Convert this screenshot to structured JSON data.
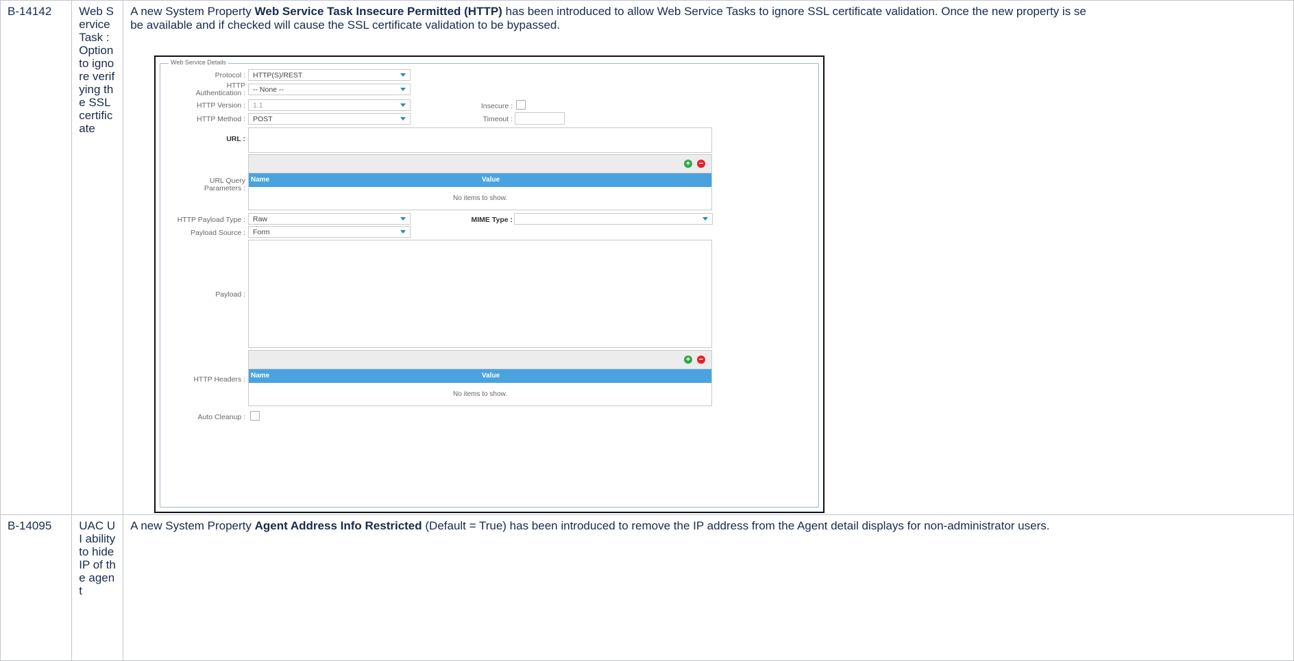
{
  "rows": [
    {
      "id": "B-14142",
      "title": "Web Service Task : Option to ignore verifying the SSL certificate",
      "desc_pre": "A new System Property ",
      "desc_bold": "Web Service Task Insecure Permitted (HTTP)",
      "desc_post": " has been introduced to allow Web Service Tasks to ignore SSL certificate validation. Once the new property is se",
      "desc_line2": "be available and if checked will cause the SSL certificate validation to be bypassed."
    },
    {
      "id": "B-14095",
      "title": "UAC UI ability to hide IP of the agent",
      "desc_pre": "A new System Property ",
      "desc_bold": "Agent Address Info Restricted",
      "desc_post": " (Default = True) has been introduced to remove the IP address from the Agent detail displays for non-administrator users."
    }
  ],
  "form": {
    "legend": "Web Service Details",
    "protocol_label": "Protocol :",
    "protocol_value": "HTTP(S)/REST",
    "auth_label_1": "HTTP",
    "auth_label_2": "Authentication :",
    "auth_value": "-- None --",
    "version_label": "HTTP Version :",
    "version_value": "1.1",
    "insecure_label": "Insecure :",
    "method_label": "HTTP Method :",
    "method_value": "POST",
    "timeout_label": "Timeout :",
    "url_label": "URL :",
    "query_label_1": "URL Query",
    "query_label_2": "Parameters :",
    "grid_name": "Name",
    "grid_value": "Value",
    "grid_empty": "No items to show.",
    "payload_type_label": "HTTP Payload Type :",
    "payload_type_value": "Raw",
    "mime_label": "MIME Type :",
    "mime_value": "",
    "payload_source_label": "Payload Source :",
    "payload_source_value": "Form",
    "payload_label": "Payload :",
    "headers_label": "HTTP Headers :",
    "cleanup_label": "Auto Cleanup :"
  }
}
